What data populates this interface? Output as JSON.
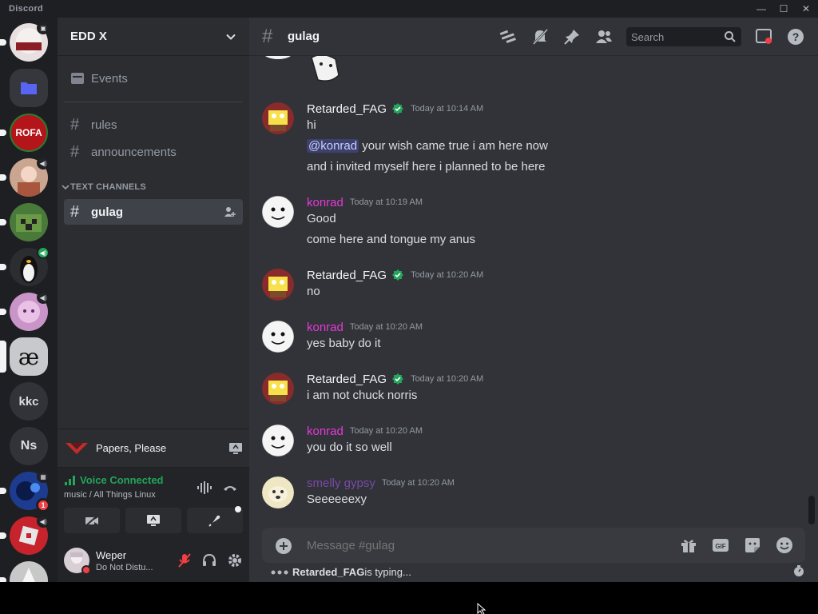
{
  "window": {
    "app_name": "Discord",
    "controls": [
      "—",
      "☐",
      "✕"
    ]
  },
  "servers": [
    {
      "initials": "",
      "color": "#e8dfe0",
      "badge": "camera"
    },
    {
      "initials": "",
      "color": "#5865f2",
      "icon": "folder"
    },
    {
      "initials": "ROFA",
      "color": "#b3151a"
    },
    {
      "initials": "",
      "color": "#caa58f",
      "badge": "speaker"
    },
    {
      "initials": "",
      "color": "#4a7a3a"
    },
    {
      "initials": "",
      "color": "#2b2d31",
      "badge": "speaker-green"
    },
    {
      "initials": "",
      "color": "#c994c8",
      "badge": "speaker"
    },
    {
      "initials": "æ",
      "color": "#4e5058"
    },
    {
      "initials": "kkc",
      "color": "#313338"
    },
    {
      "initials": "Ns",
      "color": "#313338"
    },
    {
      "initials": "",
      "color": "#1d3c8f",
      "badge": "calendar",
      "count": "1"
    },
    {
      "initials": "",
      "color": "#c6232c",
      "badge": "speaker"
    },
    {
      "initials": "",
      "color": "#c8c8c8"
    }
  ],
  "guild": {
    "name": "EDD X"
  },
  "channels": {
    "events_label": "Events",
    "top": [
      {
        "name": "rules"
      },
      {
        "name": "announcements"
      }
    ],
    "category": "TEXT CHANNELS",
    "text": [
      {
        "name": "gulag",
        "active": true
      }
    ]
  },
  "activity": {
    "name": "Papers, Please"
  },
  "voice": {
    "status": "Voice Connected",
    "location": "music / All Things Linux"
  },
  "user": {
    "name": "Weper",
    "status": "Do Not Distu..."
  },
  "chat_header": {
    "channel": "gulag",
    "search_placeholder": "Search"
  },
  "messages": [
    {
      "author": "Retarded_FAG",
      "author_color": "#f2f3f5",
      "verified": true,
      "time": "Today at 10:14 AM",
      "lines": [
        "hi"
      ],
      "mention_line": {
        "mention": "@konrad",
        "text": " your wish came true i am here now"
      },
      "after": [
        "and i invited myself here i planned to be here"
      ]
    },
    {
      "author": "konrad",
      "author_color": "#e838d9",
      "time": "Today at 10:19 AM",
      "lines": [
        "Good",
        "come here and tongue my anus"
      ]
    },
    {
      "author": "Retarded_FAG",
      "author_color": "#f2f3f5",
      "verified": true,
      "time": "Today at 10:20 AM",
      "lines": [
        "no"
      ]
    },
    {
      "author": "konrad",
      "author_color": "#e838d9",
      "time": "Today at 10:20 AM",
      "lines": [
        "yes baby do it"
      ]
    },
    {
      "author": "Retarded_FAG",
      "author_color": "#f2f3f5",
      "verified": true,
      "time": "Today at 10:20 AM",
      "lines": [
        "i am not chuck norris"
      ]
    },
    {
      "author": "konrad",
      "author_color": "#e838d9",
      "time": "Today at 10:20 AM",
      "lines": [
        "you do it so well"
      ]
    },
    {
      "author": "smelly gypsy",
      "author_color": "#7a4aa8",
      "time": "Today at 10:20 AM",
      "lines": [
        "Seeeeeexy"
      ]
    }
  ],
  "composer": {
    "placeholder": "Message #gulag"
  },
  "typing": {
    "user": "Retarded_FAG",
    "suffix": " is typing..."
  }
}
